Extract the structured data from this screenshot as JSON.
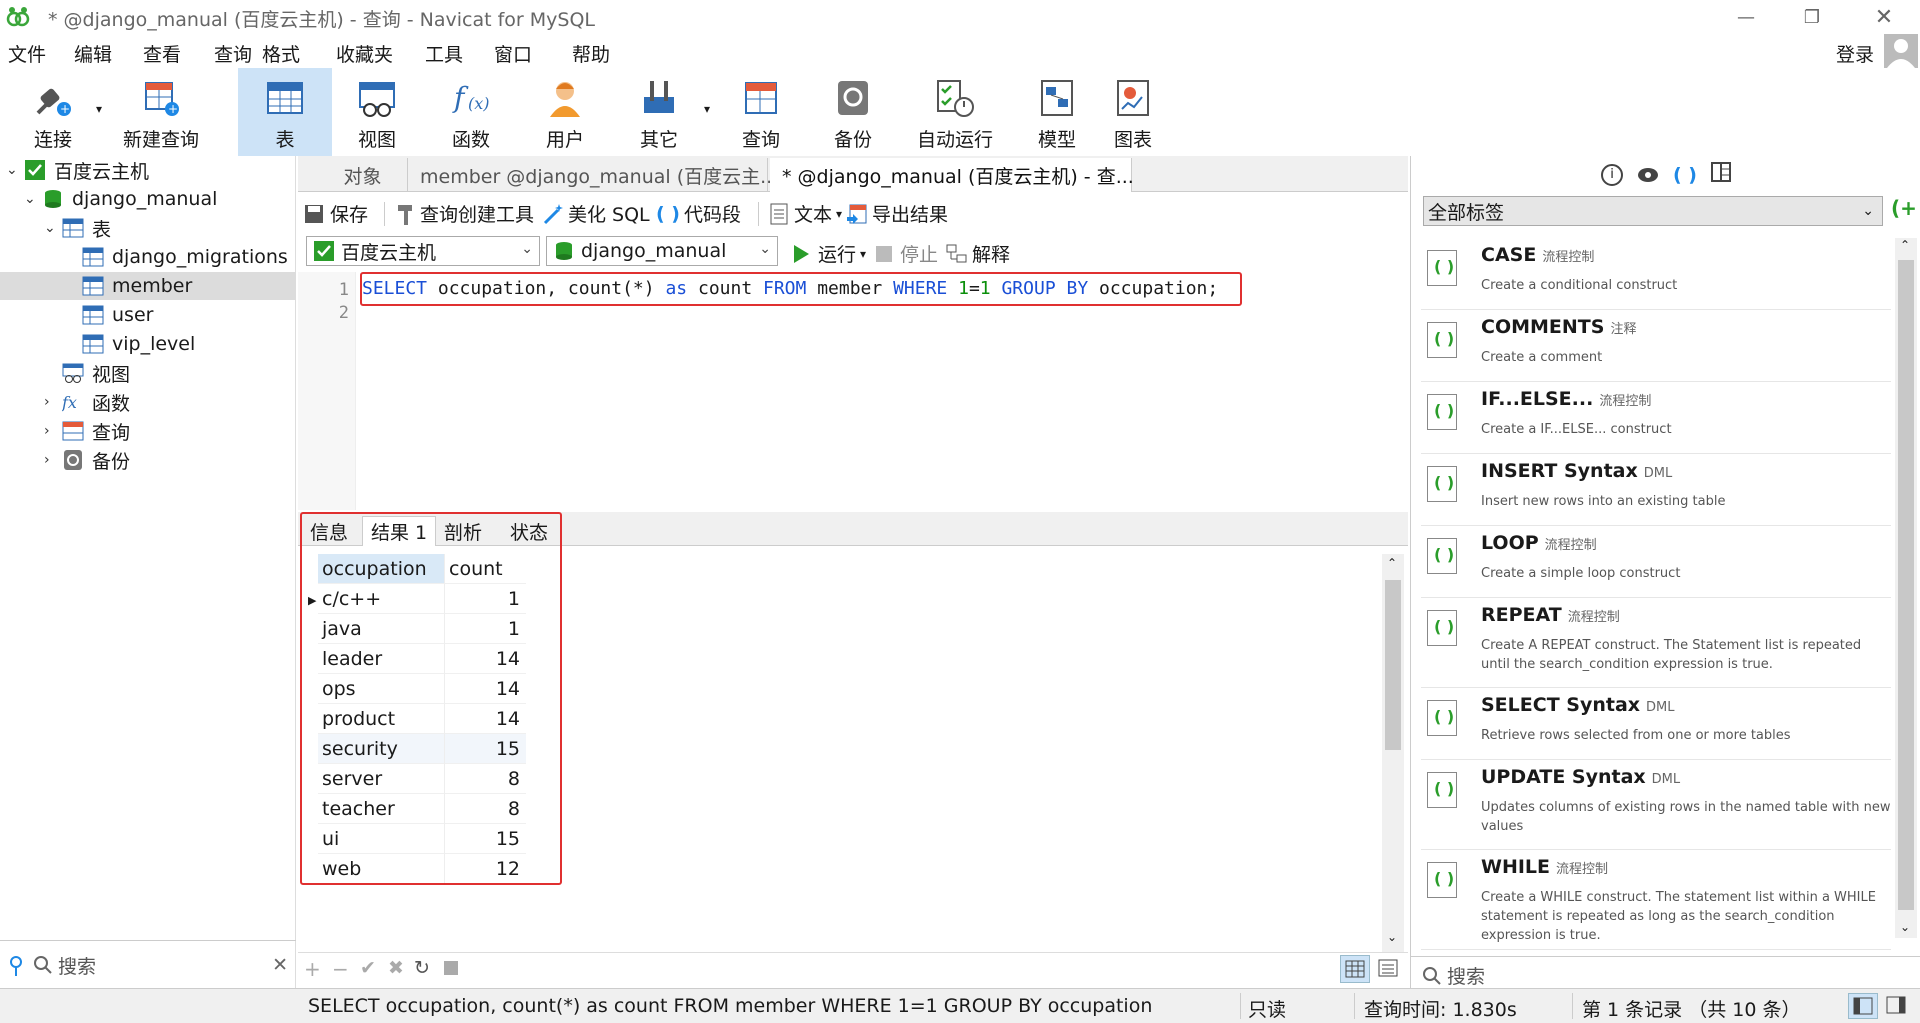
{
  "window": {
    "title": "* @django_manual (百度云主机) - 查询 - Navicat for MySQL"
  },
  "menu": [
    "文件",
    "编辑",
    "查看",
    "查询",
    "格式",
    "收藏夹",
    "工具",
    "窗口",
    "帮助"
  ],
  "login_label": "登录",
  "toolbar": [
    {
      "label": "连接",
      "icon": "plug-icon"
    },
    {
      "label": "新建查询",
      "icon": "new-query-icon"
    },
    {
      "label": "表",
      "icon": "table-icon",
      "active": true
    },
    {
      "label": "视图",
      "icon": "view-icon"
    },
    {
      "label": "函数",
      "icon": "function-icon"
    },
    {
      "label": "用户",
      "icon": "user-icon"
    },
    {
      "label": "其它",
      "icon": "tools-icon"
    },
    {
      "label": "查询",
      "icon": "query-icon"
    },
    {
      "label": "备份",
      "icon": "backup-icon"
    },
    {
      "label": "自动运行",
      "icon": "autorun-icon"
    },
    {
      "label": "模型",
      "icon": "model-icon"
    },
    {
      "label": "图表",
      "icon": "chart-icon"
    }
  ],
  "tree": {
    "connection": "百度云主机",
    "database": "django_manual",
    "tables_label": "表",
    "tables": [
      "django_migrations",
      "member",
      "user",
      "vip_level"
    ],
    "views_label": "视图",
    "functions_label": "函数",
    "queries_label": "查询",
    "backups_label": "备份"
  },
  "left_search_placeholder": "搜索",
  "tabs": [
    "对象",
    "member @django_manual (百度云主...",
    "* @django_manual (百度云主机) - 查..."
  ],
  "editor_toolbar": {
    "save": "保存",
    "builder": "查询创建工具",
    "beautify": "美化 SQL",
    "snippet": "代码段",
    "text": "文本",
    "export": "导出结果"
  },
  "db_bar": {
    "connection": "百度云主机",
    "database": "django_manual",
    "run": "运行",
    "stop": "停止",
    "explain": "解释"
  },
  "sql": {
    "select": "SELECT",
    "cols": " occupation, count(*) ",
    "as": "as",
    "alias": " count ",
    "from": "FROM",
    "table": " member ",
    "where": "WHERE",
    "one_a": "1",
    "eq": "=",
    "one_b": "1",
    "group": "GROUP BY",
    "tail": " occupation;"
  },
  "line_numbers": [
    "1",
    "2"
  ],
  "result_tabs": [
    "信息",
    "结果 1",
    "剖析",
    "状态"
  ],
  "result": {
    "columns": [
      "occupation",
      "count"
    ],
    "rows": [
      [
        "c/c++",
        "1"
      ],
      [
        "java",
        "1"
      ],
      [
        "leader",
        "14"
      ],
      [
        "ops",
        "14"
      ],
      [
        "product",
        "14"
      ],
      [
        "security",
        "15"
      ],
      [
        "server",
        "8"
      ],
      [
        "teacher",
        "8"
      ],
      [
        "ui",
        "15"
      ],
      [
        "web",
        "12"
      ]
    ]
  },
  "right_panel": {
    "filter": "全部标签",
    "search_placeholder": "搜索",
    "snippets": [
      {
        "title": "CASE",
        "tag": "流程控制",
        "desc": "Create a conditional construct"
      },
      {
        "title": "COMMENTS",
        "tag": "注释",
        "desc": "Create a comment"
      },
      {
        "title": "IF...ELSE...",
        "tag": "流程控制",
        "desc": "Create a IF...ELSE... construct"
      },
      {
        "title": "INSERT Syntax",
        "tag": "DML",
        "desc": "Insert new rows into an existing table"
      },
      {
        "title": "LOOP",
        "tag": "流程控制",
        "desc": "Create a simple loop construct"
      },
      {
        "title": "REPEAT",
        "tag": "流程控制",
        "desc": "Create A REPEAT construct. The Statement list is repeated until the search_condition expression is true."
      },
      {
        "title": "SELECT Syntax",
        "tag": "DML",
        "desc": "Retrieve rows selected from one or more tables"
      },
      {
        "title": "UPDATE Syntax",
        "tag": "DML",
        "desc": "Updates columns of existing rows in the named table with new values"
      },
      {
        "title": "WHILE",
        "tag": "流程控制",
        "desc": "Create a WHILE construct. The statement list within a WHILE statement is repeated as long as the search_condition expression is true."
      }
    ]
  },
  "status": {
    "query": "SELECT occupation, count(*) as count FROM member WHERE 1=1 GROUP BY occupation",
    "readonly": "只读",
    "time": "查询时间: 1.830s",
    "records": "第 1 条记录 （共 10 条）"
  }
}
